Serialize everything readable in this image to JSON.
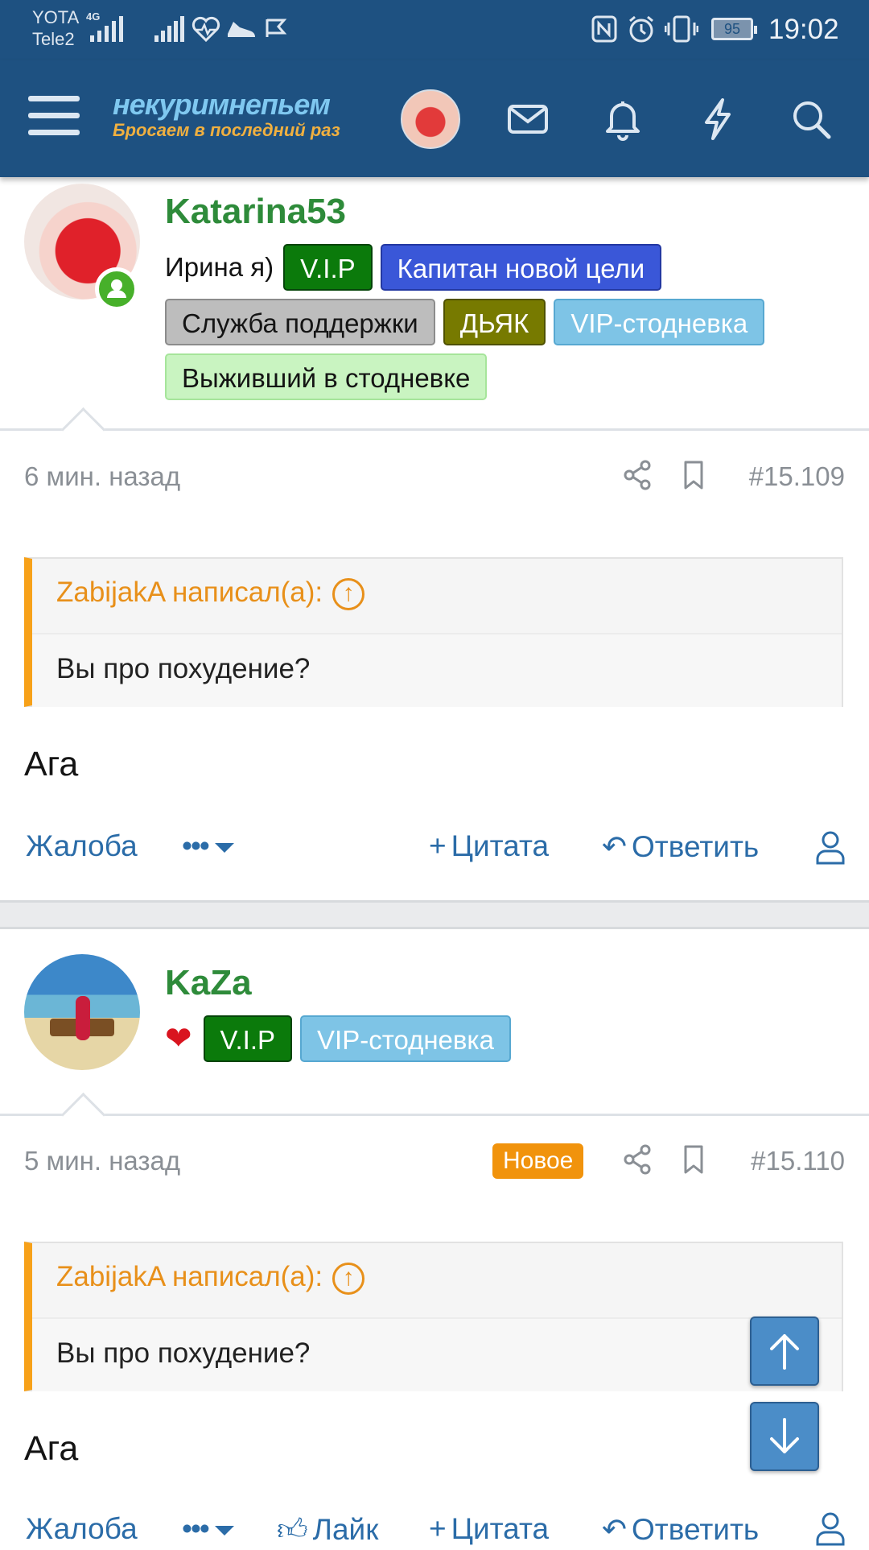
{
  "status_bar": {
    "carrier_1": "YOTA",
    "carrier_2": "Tele2",
    "network": "4G",
    "battery": "95",
    "time": "19:02"
  },
  "navbar": {
    "logo_line_1": "некуримнепьем",
    "logo_line_2": "Бросаем в последний раз",
    "icons": [
      "menu-icon",
      "avatar",
      "mail-icon",
      "bell-icon",
      "lightning-icon",
      "search-icon"
    ]
  },
  "posts": [
    {
      "username": "Katarina53",
      "title_text": "Ирина я)",
      "badges_row1": [
        "V.I.P",
        "Капитан новой цели"
      ],
      "badges_row2": [
        "Служба поддержки",
        "ДЬЯК",
        "VIP-стодневка"
      ],
      "badges_row3": [
        "Выживший в стодневке"
      ],
      "time": "6 мин. назад",
      "number": "#15.109",
      "quote_title": "ZabijakA написал(а):",
      "quote_text": "Вы про похудение?",
      "message": "Ага",
      "actions": {
        "report": "Жалоба",
        "quote": "Цитата",
        "reply": "Ответить"
      }
    },
    {
      "username": "KaZa",
      "title_icon": "heart-icon",
      "badges_row1": [
        "V.I.P",
        "VIP-стодневка"
      ],
      "time": "5 мин. назад",
      "new_label": "Новое",
      "number": "#15.110",
      "quote_title": "ZabijakA написал(а):",
      "quote_text": "Вы про похудение?",
      "message": "Ага",
      "actions": {
        "report": "Жалоба",
        "like": "Лайк",
        "quote": "Цитата",
        "reply": "Ответить"
      }
    }
  ],
  "colors": {
    "header_bg": "#1e5181",
    "username": "#2e8b3a",
    "link": "#2b6ca8",
    "quote_accent": "#f7a119",
    "new_badge": "#f1930c"
  }
}
